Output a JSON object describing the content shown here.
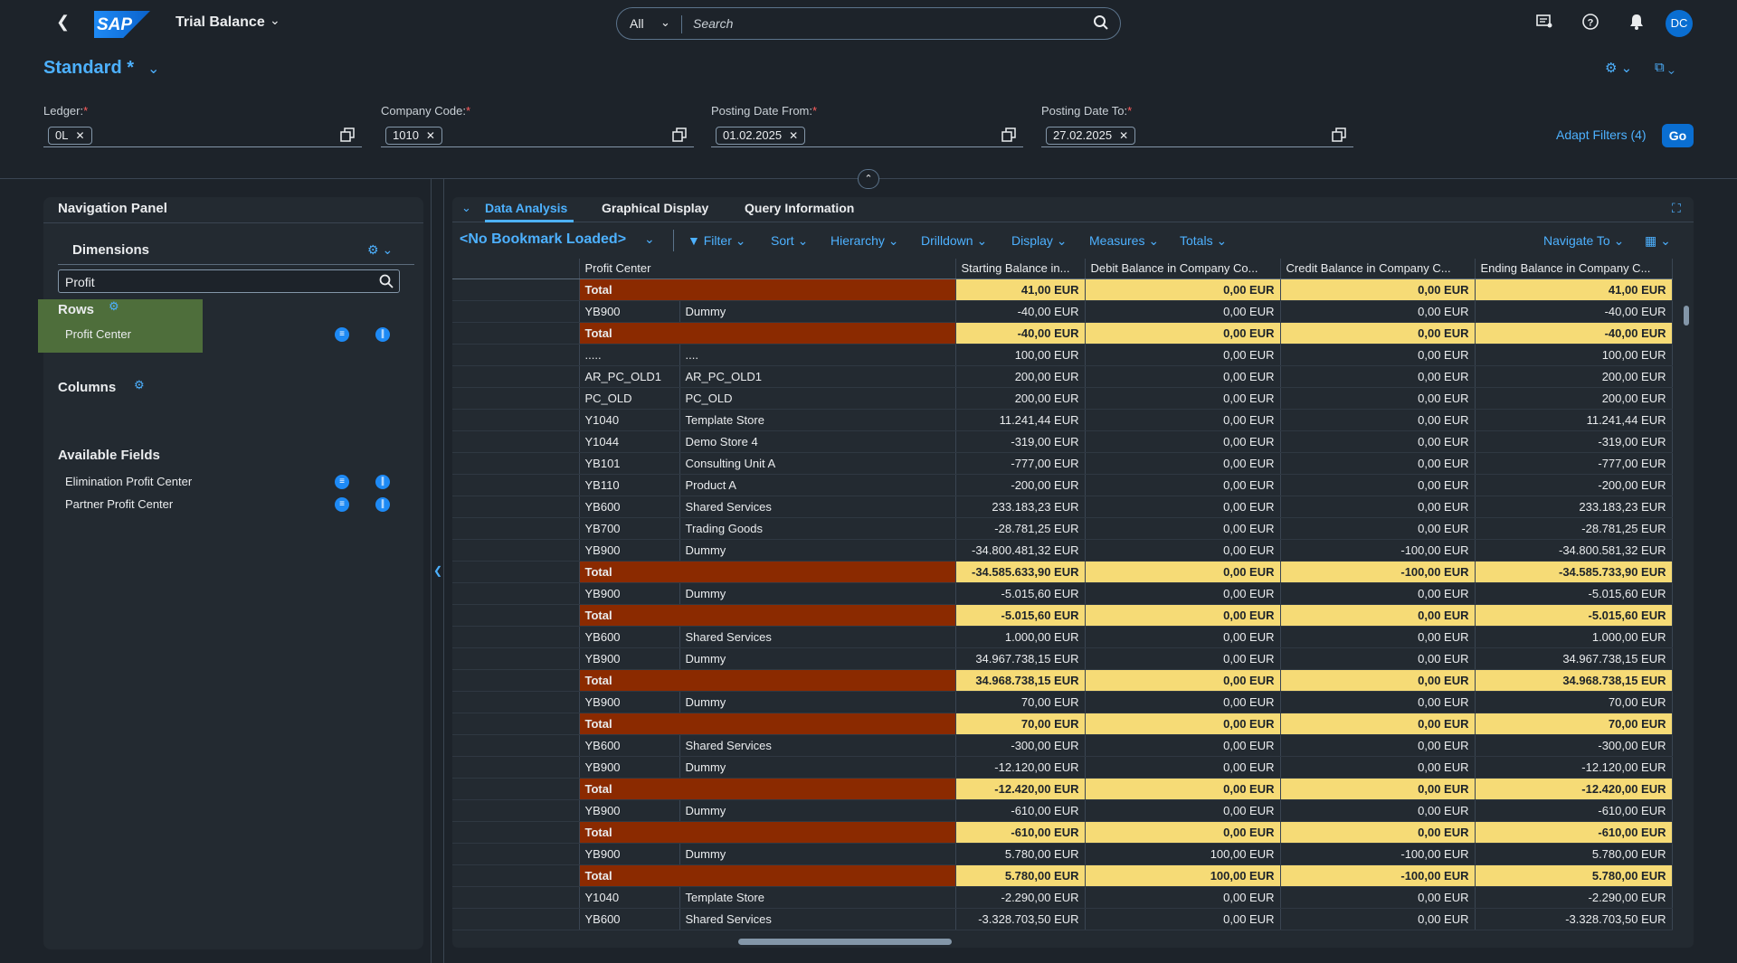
{
  "shell": {
    "app_title": "Trial Balance",
    "logo_text": "SAP",
    "search_scope": "All",
    "search_placeholder": "Search",
    "avatar_initials": "DC"
  },
  "header": {
    "variant": "Standard *",
    "filters": [
      {
        "label": "Ledger:",
        "token": "0L"
      },
      {
        "label": "Company Code:",
        "token": "1010"
      },
      {
        "label": "Posting Date From:",
        "token": "01.02.2025"
      },
      {
        "label": "Posting Date To:",
        "token": "27.02.2025"
      }
    ],
    "required_mark": "*",
    "adapt_filters": "Adapt Filters (4)",
    "go": "Go"
  },
  "nav_panel": {
    "title": "Navigation Panel",
    "dimensions_title": "Dimensions",
    "dimension_search": "Profit",
    "rows_title": "Rows",
    "rows_items": [
      "Profit Center"
    ],
    "columns_title": "Columns",
    "available_title": "Available Fields",
    "available_items": [
      "Elimination Profit Center",
      "Partner Profit Center"
    ]
  },
  "tabs": [
    "Data Analysis",
    "Graphical Display",
    "Query Information"
  ],
  "toolbar": {
    "bookmark": "<No Bookmark Loaded>",
    "items": [
      "Filter",
      "Sort",
      "Hierarchy",
      "Drilldown",
      "Display",
      "Measures",
      "Totals",
      "Navigate To"
    ]
  },
  "table": {
    "headers": [
      "",
      "Profit Center",
      "",
      "Starting Balance in...",
      "Debit Balance in Company Co...",
      "Credit Balance in Company C...",
      "Ending Balance in Company C..."
    ],
    "rows": [
      {
        "type": "total",
        "c1": "Total",
        "c2": "",
        "v": [
          "41,00 EUR",
          "0,00 EUR",
          "0,00 EUR",
          "41,00 EUR"
        ]
      },
      {
        "type": "data",
        "c1": "YB900",
        "c2": "Dummy",
        "v": [
          "-40,00 EUR",
          "0,00 EUR",
          "0,00 EUR",
          "-40,00 EUR"
        ]
      },
      {
        "type": "total",
        "c1": "Total",
        "c2": "",
        "v": [
          "-40,00 EUR",
          "0,00 EUR",
          "0,00 EUR",
          "-40,00 EUR"
        ]
      },
      {
        "type": "data",
        "c1": ".....",
        "c2": "....",
        "v": [
          "100,00 EUR",
          "0,00 EUR",
          "0,00 EUR",
          "100,00 EUR"
        ]
      },
      {
        "type": "data",
        "c1": "AR_PC_OLD1",
        "c2": "AR_PC_OLD1",
        "v": [
          "200,00 EUR",
          "0,00 EUR",
          "0,00 EUR",
          "200,00 EUR"
        ]
      },
      {
        "type": "data",
        "c1": "PC_OLD",
        "c2": "PC_OLD",
        "v": [
          "200,00 EUR",
          "0,00 EUR",
          "0,00 EUR",
          "200,00 EUR"
        ]
      },
      {
        "type": "data",
        "c1": "Y1040",
        "c2": "Template Store",
        "v": [
          "11.241,44 EUR",
          "0,00 EUR",
          "0,00 EUR",
          "11.241,44 EUR"
        ]
      },
      {
        "type": "data",
        "c1": "Y1044",
        "c2": "Demo Store 4",
        "v": [
          "-319,00 EUR",
          "0,00 EUR",
          "0,00 EUR",
          "-319,00 EUR"
        ]
      },
      {
        "type": "data",
        "c1": "YB101",
        "c2": "Consulting Unit A",
        "v": [
          "-777,00 EUR",
          "0,00 EUR",
          "0,00 EUR",
          "-777,00 EUR"
        ]
      },
      {
        "type": "data",
        "c1": "YB110",
        "c2": "Product A",
        "v": [
          "-200,00 EUR",
          "0,00 EUR",
          "0,00 EUR",
          "-200,00 EUR"
        ]
      },
      {
        "type": "data",
        "c1": "YB600",
        "c2": "Shared Services",
        "v": [
          "233.183,23 EUR",
          "0,00 EUR",
          "0,00 EUR",
          "233.183,23 EUR"
        ]
      },
      {
        "type": "data",
        "c1": "YB700",
        "c2": "Trading Goods",
        "v": [
          "-28.781,25 EUR",
          "0,00 EUR",
          "0,00 EUR",
          "-28.781,25 EUR"
        ]
      },
      {
        "type": "data",
        "c1": "YB900",
        "c2": "Dummy",
        "v": [
          "-34.800.481,32 EUR",
          "0,00 EUR",
          "-100,00 EUR",
          "-34.800.581,32 EUR"
        ]
      },
      {
        "type": "total",
        "c1": "Total",
        "c2": "",
        "v": [
          "-34.585.633,90 EUR",
          "0,00 EUR",
          "-100,00 EUR",
          "-34.585.733,90 EUR"
        ]
      },
      {
        "type": "data",
        "c1": "YB900",
        "c2": "Dummy",
        "v": [
          "-5.015,60 EUR",
          "0,00 EUR",
          "0,00 EUR",
          "-5.015,60 EUR"
        ]
      },
      {
        "type": "total",
        "c1": "Total",
        "c2": "",
        "v": [
          "-5.015,60 EUR",
          "0,00 EUR",
          "0,00 EUR",
          "-5.015,60 EUR"
        ]
      },
      {
        "type": "data",
        "c1": "YB600",
        "c2": "Shared Services",
        "v": [
          "1.000,00 EUR",
          "0,00 EUR",
          "0,00 EUR",
          "1.000,00 EUR"
        ]
      },
      {
        "type": "data",
        "c1": "YB900",
        "c2": "Dummy",
        "v": [
          "34.967.738,15 EUR",
          "0,00 EUR",
          "0,00 EUR",
          "34.967.738,15 EUR"
        ]
      },
      {
        "type": "total",
        "c1": "Total",
        "c2": "",
        "v": [
          "34.968.738,15 EUR",
          "0,00 EUR",
          "0,00 EUR",
          "34.968.738,15 EUR"
        ]
      },
      {
        "type": "data",
        "c1": "YB900",
        "c2": "Dummy",
        "v": [
          "70,00 EUR",
          "0,00 EUR",
          "0,00 EUR",
          "70,00 EUR"
        ]
      },
      {
        "type": "total",
        "c1": "Total",
        "c2": "",
        "v": [
          "70,00 EUR",
          "0,00 EUR",
          "0,00 EUR",
          "70,00 EUR"
        ]
      },
      {
        "type": "data",
        "c1": "YB600",
        "c2": "Shared Services",
        "v": [
          "-300,00 EUR",
          "0,00 EUR",
          "0,00 EUR",
          "-300,00 EUR"
        ]
      },
      {
        "type": "data",
        "c1": "YB900",
        "c2": "Dummy",
        "v": [
          "-12.120,00 EUR",
          "0,00 EUR",
          "0,00 EUR",
          "-12.120,00 EUR"
        ]
      },
      {
        "type": "total",
        "c1": "Total",
        "c2": "",
        "v": [
          "-12.420,00 EUR",
          "0,00 EUR",
          "0,00 EUR",
          "-12.420,00 EUR"
        ]
      },
      {
        "type": "data",
        "c1": "YB900",
        "c2": "Dummy",
        "v": [
          "-610,00 EUR",
          "0,00 EUR",
          "0,00 EUR",
          "-610,00 EUR"
        ]
      },
      {
        "type": "total",
        "c1": "Total",
        "c2": "",
        "v": [
          "-610,00 EUR",
          "0,00 EUR",
          "0,00 EUR",
          "-610,00 EUR"
        ]
      },
      {
        "type": "data",
        "c1": "YB900",
        "c2": "Dummy",
        "v": [
          "5.780,00 EUR",
          "100,00 EUR",
          "-100,00 EUR",
          "5.780,00 EUR"
        ]
      },
      {
        "type": "total",
        "c1": "Total",
        "c2": "",
        "v": [
          "5.780,00 EUR",
          "100,00 EUR",
          "-100,00 EUR",
          "5.780,00 EUR"
        ]
      },
      {
        "type": "data",
        "c1": "Y1040",
        "c2": "Template Store",
        "v": [
          "-2.290,00 EUR",
          "0,00 EUR",
          "0,00 EUR",
          "-2.290,00 EUR"
        ]
      },
      {
        "type": "data",
        "c1": "YB600",
        "c2": "Shared Services",
        "v": [
          "-3.328.703,50 EUR",
          "0,00 EUR",
          "0,00 EUR",
          "-3.328.703,50 EUR"
        ]
      }
    ]
  },
  "colors": {
    "accent": "#4db1ff",
    "total_label_bg": "#8b2a00",
    "total_value_bg": "#f6db76",
    "rows_highlight": "#4e6e3b"
  }
}
